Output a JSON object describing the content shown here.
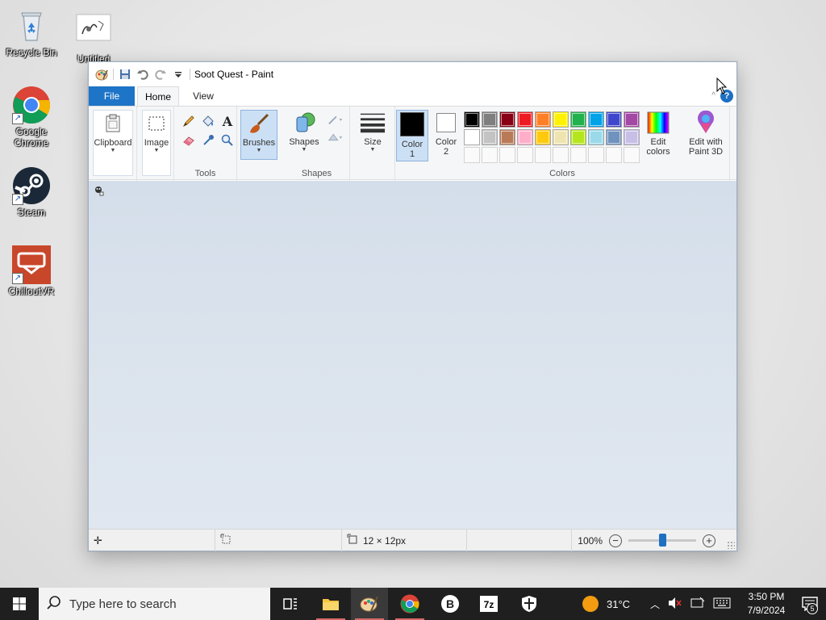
{
  "desktop": {
    "icons": [
      {
        "label": "Recycle Bin"
      },
      {
        "label": "Untitled"
      },
      {
        "label": "Google Chrome"
      },
      {
        "label": "Steam"
      },
      {
        "label": "ChilloutVR"
      }
    ]
  },
  "paint": {
    "title": "Soot Quest - Paint",
    "tabs": {
      "file": "File",
      "home": "Home",
      "view": "View"
    },
    "help": "?",
    "ribbon": {
      "clipboard": "Clipboard",
      "image": "Image",
      "tools_group": "Tools",
      "brushes": "Brushes",
      "shapes": "Shapes",
      "shapes_group": "Shapes",
      "size": "Size",
      "color1": {
        "line1": "Color",
        "line2": "1"
      },
      "color2": {
        "line1": "Color",
        "line2": "2"
      },
      "colors_group": "Colors",
      "edit_colors": {
        "line1": "Edit",
        "line2": "colors"
      },
      "paint3d": {
        "line1": "Edit with",
        "line2": "Paint 3D"
      }
    },
    "colors": {
      "color1": "#000000",
      "color2": "#ffffff",
      "palette_row1": [
        "#000000",
        "#7f7f7f",
        "#880015",
        "#ed1c24",
        "#ff7f27",
        "#fff200",
        "#22b14c",
        "#00a2e8",
        "#3f48cc",
        "#a349a4"
      ],
      "palette_row2": [
        "#ffffff",
        "#c3c3c3",
        "#b97a57",
        "#ffaec9",
        "#ffc90e",
        "#efe4b0",
        "#b5e61d",
        "#99d9ea",
        "#7092be",
        "#c8bfe7"
      ],
      "accent": "#1e74c7"
    },
    "status": {
      "image_size": "12 × 12px",
      "zoom": "100%"
    }
  },
  "taskbar": {
    "search_placeholder": "Type here to search",
    "weather": "31°C",
    "time": "3:50 PM",
    "date": "7/9/2024",
    "notification_count": "5"
  }
}
